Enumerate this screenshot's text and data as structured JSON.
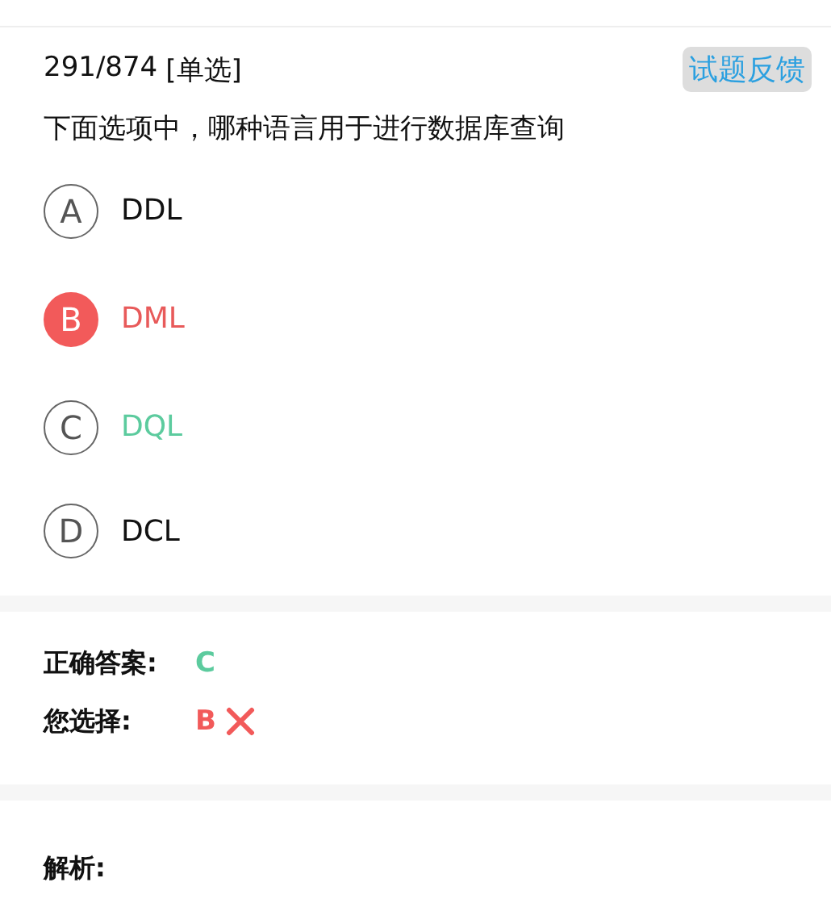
{
  "question": {
    "progress": "291/874",
    "type": "[单选]",
    "feedback_button": "试题反馈",
    "text": "下面选项中，哪种语言用于进行数据库查询"
  },
  "options": [
    {
      "letter": "A",
      "text": "DDL",
      "selected": false,
      "correct": false
    },
    {
      "letter": "B",
      "text": "DML",
      "selected": true,
      "correct": false
    },
    {
      "letter": "C",
      "text": "DQL",
      "selected": false,
      "correct": true
    },
    {
      "letter": "D",
      "text": "DCL",
      "selected": false,
      "correct": false
    }
  ],
  "result": {
    "correct_label": "正确答案:",
    "correct_value": "C",
    "chosen_label": "您选择:",
    "chosen_value": "B",
    "chosen_wrong": true
  },
  "analysis": {
    "label": "解析:"
  }
}
